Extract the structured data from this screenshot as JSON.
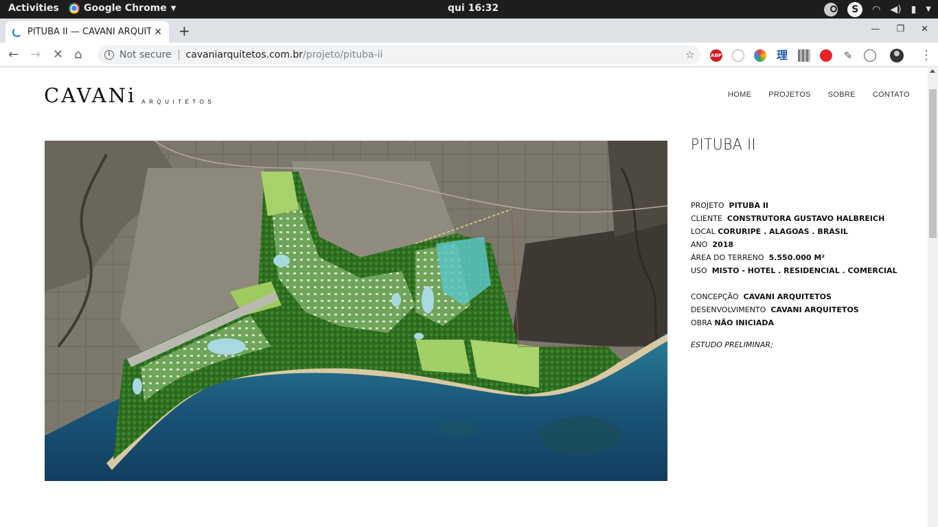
{
  "os": {
    "activities": "Activities",
    "app_name": "Google Chrome",
    "clock": "qui 16:32",
    "skype_letter": "S"
  },
  "browser": {
    "tab_title": "PITUBA II — CAVANI ARQUITETOS",
    "url_security": "Not secure",
    "url_domain": "cavaniarquitetos.com.br",
    "url_path": "/projeto/pituba-ii",
    "ext_abp_label": "ABP",
    "ext_li_label": "理"
  },
  "site": {
    "logo_main": "CAVANi",
    "logo_sub": "ARQUITETOS",
    "nav": [
      "HOME",
      "PROJETOS",
      "SOBRE",
      "CONTATO"
    ]
  },
  "project": {
    "title": "PITUBA II",
    "fields": [
      {
        "label": "PROJETO",
        "value": "PITUBA II"
      },
      {
        "label": "CLIENTE",
        "value": "CONSTRUTORA GUSTAVO HALBREICH"
      },
      {
        "label": "LOCAL",
        "value": "CORURIPE . ALAGOAS . BRASIL"
      },
      {
        "label": "ANO",
        "value": "2018"
      },
      {
        "label": "ÁREA DO TERRENO",
        "value": "5.550.000 M²"
      },
      {
        "label": "USO",
        "value": "MISTO - HOTEL . RESIDENCIAL . COMERCIAL"
      }
    ],
    "credits": [
      {
        "label": "CONCEPÇÃO",
        "value": "CAVANI ARQUITETOS"
      },
      {
        "label": "DESENVOLVIMENTO",
        "value": "CAVANI ARQUITETOS"
      },
      {
        "label": "OBRA",
        "value": "NÃO INICIADA"
      }
    ],
    "note": "ESTUDO PRELIMINAR;"
  },
  "colors": {
    "ocean": "#1d5a7e",
    "vegetation": "#3f8f2a",
    "terrain": "#8a857a"
  }
}
